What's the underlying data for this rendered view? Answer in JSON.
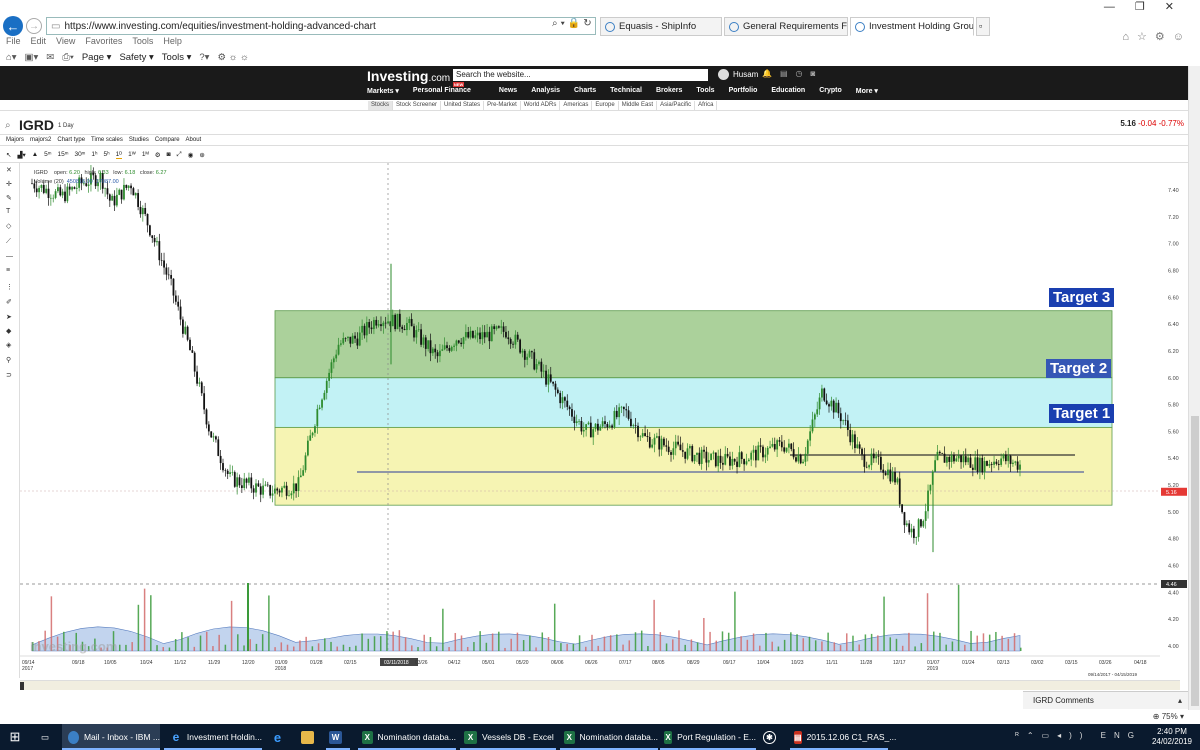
{
  "browser": {
    "url": "https://www.investing.com/equities/investment-holding-advanced-chart",
    "tabs": [
      {
        "label": "Equasis - ShipInfo",
        "active": false
      },
      {
        "label": "General Requirements For Utili...",
        "active": false
      },
      {
        "label": "Investment Holding Group ...",
        "active": true
      }
    ],
    "menu": [
      "File",
      "Edit",
      "View",
      "Favorites",
      "Tools",
      "Help"
    ],
    "commands": [
      "Page ▾",
      "Safety ▾",
      "Tools ▾"
    ]
  },
  "site": {
    "logo_main": "Investing",
    "logo_suffix": ".com",
    "search_placeholder": "Search the website...",
    "user": "Husam",
    "nav": [
      "Markets ▾",
      "Personal Finance",
      "News",
      "Analysis",
      "Charts",
      "Technical",
      "Brokers",
      "Tools",
      "Portfolio",
      "Education",
      "Crypto",
      "More ▾"
    ],
    "nav_badge": "NEW",
    "subnav": [
      "Stocks",
      "Stock Screener",
      "United States",
      "Pre-Market",
      "World ADRs",
      "Americas",
      "Europe",
      "Middle East",
      "Asia/Pacific",
      "Africa"
    ]
  },
  "symbol": {
    "name": "IGRD",
    "interval": "1 Day",
    "price": "5.16",
    "change": "-0.04",
    "change_pct": "-0.77%"
  },
  "chart_menu": [
    "Majors",
    "majors2",
    "Chart type",
    "Time scales",
    "Studies",
    "Compare",
    "About"
  ],
  "chart_tools": [
    "5ᵐ",
    "15ᵐ",
    "30ᵐ",
    "1ʰ",
    "5ʰ",
    "1ᴰ",
    "1ᵂ",
    "1ᴹ"
  ],
  "legend": {
    "symbol": "IGRD",
    "open_label": "open:",
    "open": "6.20",
    "high_label": "high:",
    "high": "6.33",
    "low_label": "low:",
    "low": "6.18",
    "close_label": "close:",
    "close": "6.27",
    "volume_label": "Volume (20)",
    "volume": "450816.00",
    "volume_ma": "17087.00"
  },
  "targets": [
    "Target 3",
    "Target 2",
    "Target 1"
  ],
  "comments_label": "IGRD Comments",
  "zoom": "75%",
  "chart_data": {
    "type": "candlestick",
    "y_axis_labels": [
      "7.40",
      "7.20",
      "7.00",
      "6.80",
      "6.60",
      "6.40",
      "6.20",
      "6.00",
      "5.80",
      "5.60",
      "5.40",
      "5.20",
      "5.00",
      "4.80",
      "4.60",
      "4.40",
      "4.20",
      "4.00"
    ],
    "x_axis_labels": [
      "09/14 2017",
      "09/18",
      "10/05",
      "10/24",
      "11/12",
      "11/29",
      "12/20",
      "01/09 2018",
      "01/28",
      "02/15",
      "03/11/2018",
      "03/26",
      "04/12",
      "05/01",
      "05/20",
      "06/06",
      "06/26",
      "07/17",
      "08/05",
      "08/29",
      "09/17",
      "10/04",
      "10/23",
      "11/11",
      "11/28",
      "12/17",
      "01/07 2019",
      "01/24",
      "02/13",
      "03/02",
      "03/15",
      "03/26",
      "04/18"
    ],
    "price_tag": "5.16",
    "crosshair_price": "4.46",
    "range_label": "09/14/2017 - 04/15/2019",
    "zones": [
      {
        "label": "Target 3",
        "low": 6.0,
        "high": 6.5,
        "color": "#8fc27a"
      },
      {
        "label": "Target 2",
        "low": 5.63,
        "high": 6.0,
        "color": "#aeeef2"
      },
      {
        "label": "Target 1",
        "low": 5.05,
        "high": 5.63,
        "color": "#f3f09a"
      }
    ],
    "lines": [
      {
        "value": 5.3,
        "color": "#2a3a9a"
      },
      {
        "value": 5.43,
        "color": "#333333"
      }
    ],
    "price_path": [
      [
        0,
        7.45
      ],
      [
        0.03,
        7.35
      ],
      [
        0.05,
        7.45
      ],
      [
        0.07,
        7.5
      ],
      [
        0.08,
        7.3
      ],
      [
        0.1,
        7.45
      ],
      [
        0.12,
        7.1
      ],
      [
        0.14,
        6.7
      ],
      [
        0.16,
        6.2
      ],
      [
        0.18,
        5.6
      ],
      [
        0.2,
        5.25
      ],
      [
        0.22,
        5.2
      ],
      [
        0.24,
        5.15
      ],
      [
        0.27,
        5.2
      ],
      [
        0.29,
        5.8
      ],
      [
        0.31,
        6.25
      ],
      [
        0.33,
        6.3
      ],
      [
        0.35,
        6.45
      ],
      [
        0.38,
        6.4
      ],
      [
        0.41,
        6.15
      ],
      [
        0.43,
        6.3
      ],
      [
        0.45,
        6.3
      ],
      [
        0.48,
        6.35
      ],
      [
        0.51,
        6.1
      ],
      [
        0.53,
        5.9
      ],
      [
        0.56,
        5.6
      ],
      [
        0.58,
        5.65
      ],
      [
        0.6,
        5.75
      ],
      [
        0.62,
        5.55
      ],
      [
        0.64,
        5.5
      ],
      [
        0.66,
        5.45
      ],
      [
        0.68,
        5.4
      ],
      [
        0.7,
        5.38
      ],
      [
        0.72,
        5.4
      ],
      [
        0.74,
        5.45
      ],
      [
        0.76,
        5.5
      ],
      [
        0.78,
        5.4
      ],
      [
        0.8,
        5.9
      ],
      [
        0.82,
        5.7
      ],
      [
        0.84,
        5.4
      ],
      [
        0.86,
        5.35
      ],
      [
        0.88,
        5.2
      ],
      [
        0.9,
        5.35
      ],
      [
        0.92,
        5.4
      ],
      [
        0.94,
        5.4
      ],
      [
        0.96,
        5.35
      ],
      [
        0.98,
        5.4
      ],
      [
        1.0,
        5.35
      ]
    ]
  }
}
